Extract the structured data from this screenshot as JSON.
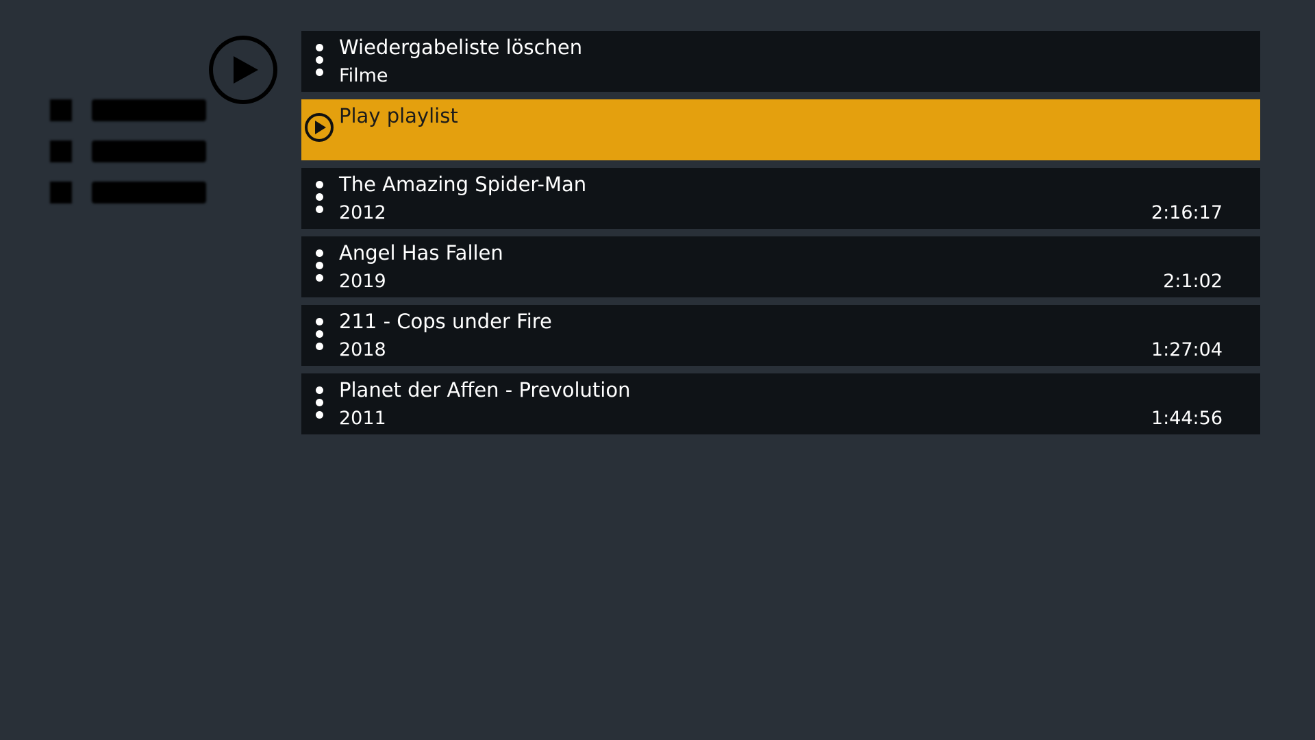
{
  "sidebar": {
    "playlist_icon": "playlist-icon",
    "play_icon": "play-circle-icon"
  },
  "colors": {
    "background": "#293038",
    "row_background": "#0f1317",
    "focus_accent": "#e4a00e",
    "text": "#ffffff"
  },
  "list": {
    "items": [
      {
        "type": "action",
        "icon": "more-vertical-icon",
        "title": "Wiedergabeliste löschen",
        "subtitle": "Filme",
        "duration": ""
      },
      {
        "type": "action",
        "focused": true,
        "icon": "play-circle-icon",
        "title": "Play playlist",
        "subtitle": "",
        "duration": ""
      },
      {
        "type": "movie",
        "icon": "more-vertical-icon",
        "title": "The Amazing Spider-Man",
        "subtitle": "2012",
        "duration": "2:16:17"
      },
      {
        "type": "movie",
        "icon": "more-vertical-icon",
        "title": "Angel Has Fallen",
        "subtitle": "2019",
        "duration": "2:1:02"
      },
      {
        "type": "movie",
        "icon": "more-vertical-icon",
        "title": "211 - Cops under Fire",
        "subtitle": "2018",
        "duration": "1:27:04"
      },
      {
        "type": "movie",
        "icon": "more-vertical-icon",
        "title": "Planet der Affen - Prevolution",
        "subtitle": "2011",
        "duration": "1:44:56"
      }
    ]
  }
}
